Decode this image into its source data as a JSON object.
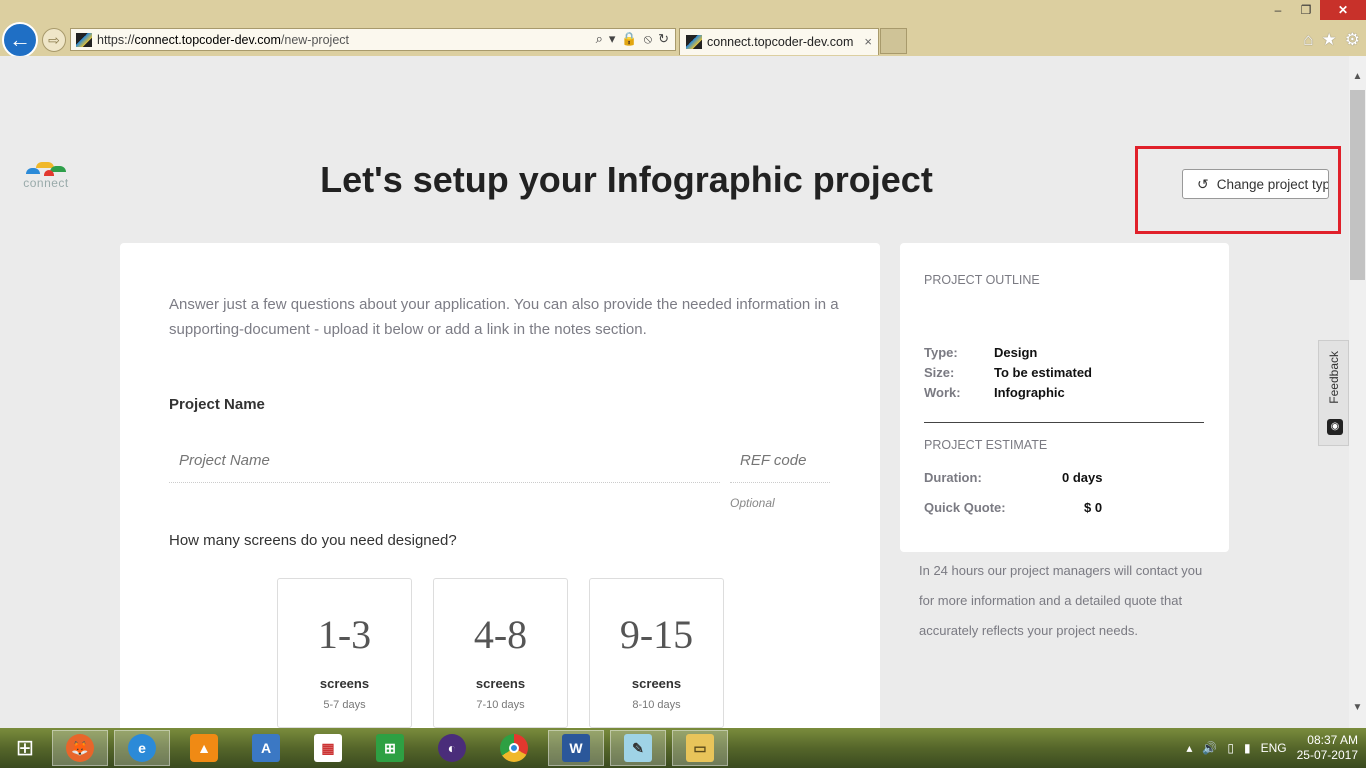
{
  "browser": {
    "url_scheme": "https://",
    "url_host": "connect.topcoder-dev.com",
    "url_path": "/new-project",
    "tab_title": "connect.topcoder-dev.com",
    "tab_close": "×",
    "win_min": "–",
    "win_max": "❐",
    "win_close": "✕"
  },
  "logo": {
    "text": "connect"
  },
  "page": {
    "title": "Let's setup your Infographic project",
    "change_button": "Change project type"
  },
  "form": {
    "intro": "Answer just a few questions about your application. You can also provide the needed information in a supporting-document - upload it below or add a link in the notes section.",
    "project_name_label": "Project Name",
    "project_name_placeholder": "Project Name",
    "ref_placeholder": "REF code",
    "ref_hint": "Optional",
    "screens_question": "How many screens do you need designed?",
    "screen_options": [
      {
        "range": "1-3",
        "unit": "screens",
        "days": "5-7 days"
      },
      {
        "range": "4-8",
        "unit": "screens",
        "days": "7-10 days"
      },
      {
        "range": "9-15",
        "unit": "screens",
        "days": "8-10 days"
      }
    ]
  },
  "outline": {
    "heading": "PROJECT OUTLINE",
    "type_label": "Type:",
    "type_value": "Design",
    "size_label": "Size:",
    "size_value": "To be estimated",
    "work_label": "Work:",
    "work_value": "Infographic",
    "estimate_heading": "PROJECT ESTIMATE",
    "duration_label": "Duration:",
    "duration_value": "0 days",
    "quote_label": "Quick Quote:",
    "quote_value": "$ 0",
    "contact_note": "In 24 hours our project managers will contact you for more information and a detailed quote that accurately reflects your project needs."
  },
  "feedback": {
    "label": "Feedback"
  },
  "taskbar": {
    "lang": "ENG",
    "time": "08:37 AM",
    "date": "25-07-2017"
  },
  "colors": {
    "highlight": "#e0202a",
    "back_button": "#1f6fc5",
    "chrome": "#dccfa0"
  }
}
